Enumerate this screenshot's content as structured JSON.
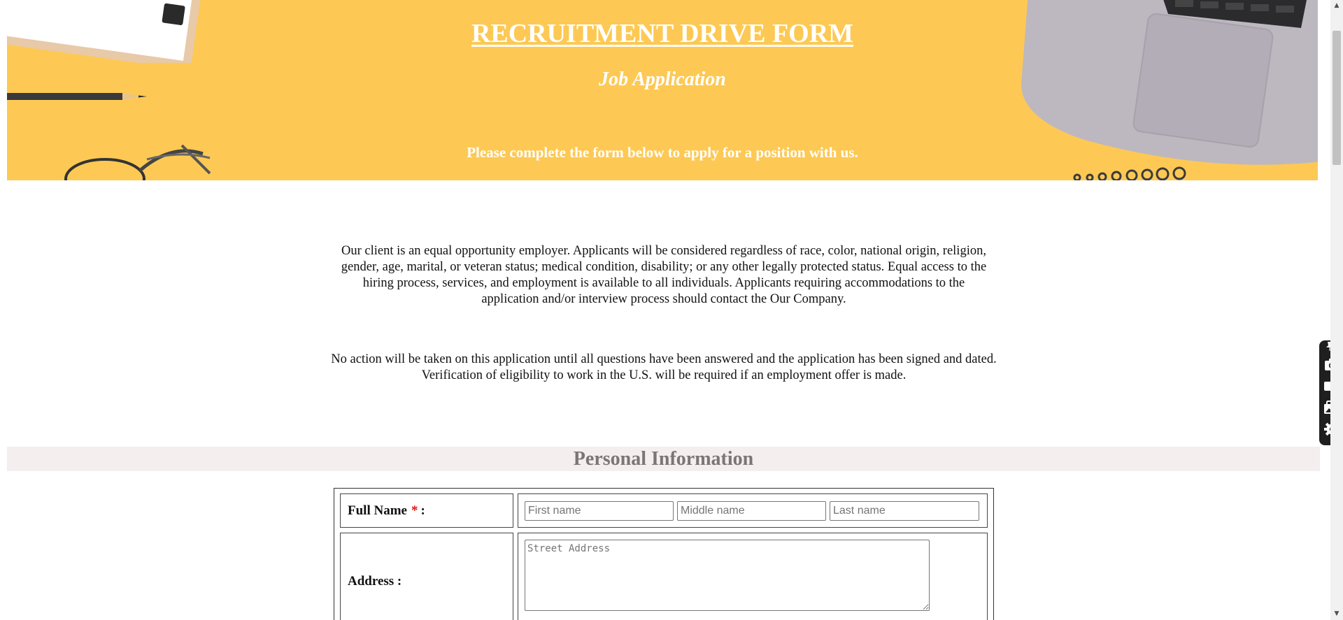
{
  "banner": {
    "title": "RECRUITMENT DRIVE FORM",
    "subtitle": "Job Application",
    "intro": "Please complete the form below to apply for a position with us."
  },
  "notices": {
    "equal_opportunity": "Our client is an equal opportunity employer. Applicants will be considered regardless of race, color, national origin, religion, gender, age, marital, or veteran status; medical condition, disability; or any other legally protected status. Equal access to the hiring process, services, and employment is available to all individuals. Applicants requiring accommodations to the application and/or interview process should contact the Our Company.",
    "no_action": "No action will be taken on this application until all questions have been answered and the application has been signed and dated. Verification of eligibility to work in the U.S. will be required if an employment offer is made."
  },
  "sections": {
    "personal": {
      "heading": "Personal Information",
      "full_name": {
        "label": "Full Name",
        "required_mark": "*",
        "suffix": ":",
        "first_placeholder": "First name",
        "middle_placeholder": "Middle name",
        "last_placeholder": "Last name"
      },
      "address": {
        "label": "Address :",
        "street_placeholder": "Street Address"
      }
    }
  },
  "tool_panel": {
    "icons": [
      "pin-icon",
      "camera-icon",
      "video-camera-icon",
      "gallery-icon",
      "settings-gear-icon"
    ]
  },
  "colors": {
    "banner_bg": "#fdc954",
    "section_bar_bg": "#f4eeee",
    "section_heading": "#7b7575",
    "required": "#e01010"
  }
}
